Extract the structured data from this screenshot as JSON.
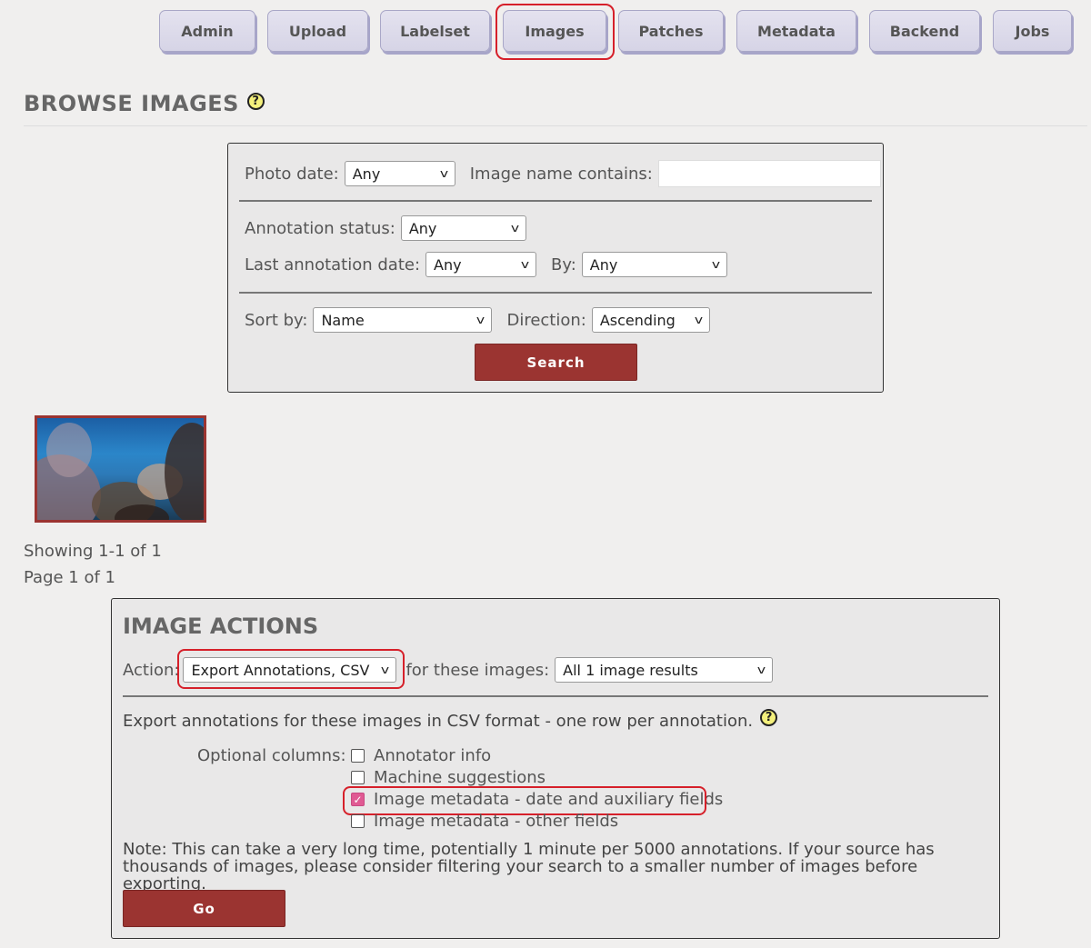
{
  "nav": {
    "items": [
      {
        "label": "Admin"
      },
      {
        "label": "Upload"
      },
      {
        "label": "Labelset"
      },
      {
        "label": "Images"
      },
      {
        "label": "Patches"
      },
      {
        "label": "Metadata"
      },
      {
        "label": "Backend"
      },
      {
        "label": "Jobs"
      }
    ],
    "active": "Images"
  },
  "page": {
    "title": "BROWSE IMAGES",
    "help_glyph": "?"
  },
  "search": {
    "photo_date_label": "Photo date:",
    "photo_date_value": "Any",
    "image_name_label": "Image name contains:",
    "image_name_value": "",
    "annotation_status_label": "Annotation status:",
    "annotation_status_value": "Any",
    "last_annotation_date_label": "Last annotation date:",
    "last_annotation_date_value": "Any",
    "by_label": "By:",
    "by_value": "Any",
    "sort_by_label": "Sort by:",
    "sort_by_value": "Name",
    "direction_label": "Direction:",
    "direction_value": "Ascending",
    "search_button": "Search"
  },
  "results": {
    "showing": "Showing 1-1 of 1",
    "page": "Page 1 of 1"
  },
  "actions": {
    "title": "IMAGE ACTIONS",
    "action_label": "Action:",
    "action_value": "Export Annotations, CSV",
    "for_images_label": "for these images:",
    "for_images_value": "All 1 image results",
    "description": "Export annotations for these images in CSV format - one row per annotation.",
    "optional_columns_label": "Optional columns:",
    "columns": [
      {
        "label": "Annotator info",
        "checked": false
      },
      {
        "label": "Machine suggestions",
        "checked": false
      },
      {
        "label": "Image metadata - date and auxiliary fields",
        "checked": true
      },
      {
        "label": "Image metadata - other fields",
        "checked": false
      }
    ],
    "note": "Note: This can take a very long time, potentially 1 minute per 5000 annotations. If your source has thousands of images, please consider filtering your search to a smaller number of images before exporting.",
    "go_button": "Go",
    "check_glyph": "✓",
    "chevron_glyph": "v"
  },
  "colors": {
    "accent_red": "#9b3431",
    "highlight_red": "#d6202a",
    "nav_button": "#dcdaea",
    "checkbox_checked": "#e05a93"
  }
}
